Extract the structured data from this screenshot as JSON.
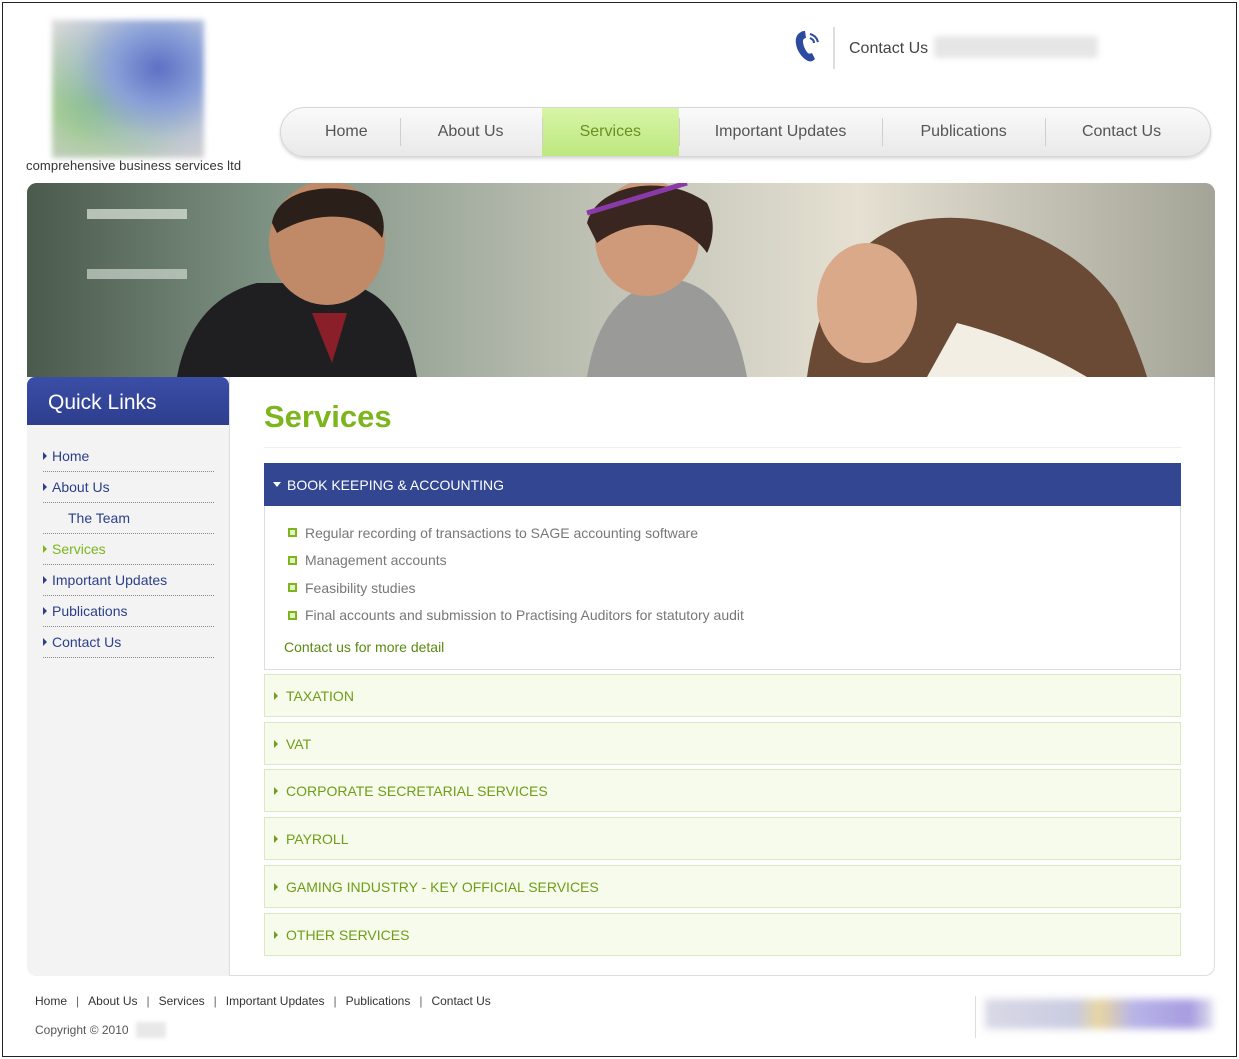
{
  "header": {
    "tagline": "comprehensive business services ltd",
    "contact_label": "Contact Us"
  },
  "nav": {
    "items": [
      {
        "label": "Home",
        "active": false
      },
      {
        "label": "About Us",
        "active": false
      },
      {
        "label": "Services",
        "active": true
      },
      {
        "label": "Important Updates",
        "active": false
      },
      {
        "label": "Publications",
        "active": false
      },
      {
        "label": "Contact Us",
        "active": false
      }
    ]
  },
  "sidebar": {
    "title": "Quick Links",
    "items": [
      {
        "label": "Home"
      },
      {
        "label": "About Us"
      },
      {
        "label": "The Team"
      },
      {
        "label": "Services"
      },
      {
        "label": "Important Updates"
      },
      {
        "label": "Publications"
      },
      {
        "label": "Contact Us"
      }
    ]
  },
  "main": {
    "title": "Services",
    "open_section": {
      "label": "BOOK KEEPING & ACCOUNTING",
      "bullets": [
        "Regular recording of transactions to SAGE accounting software",
        "Management accounts",
        "Feasibility studies",
        "Final accounts and submission to Practising Auditors for statutory audit"
      ],
      "more_link": "Contact us for more detail"
    },
    "sections": [
      "TAXATION",
      "VAT",
      "CORPORATE SECRETARIAL SERVICES",
      "PAYROLL",
      "GAMING INDUSTRY - KEY OFFICIAL SERVICES",
      "OTHER SERVICES"
    ]
  },
  "footer": {
    "links": [
      "Home",
      "About Us",
      "Services",
      "Important Updates",
      "Publications",
      "Contact Us"
    ],
    "copyright": "Copyright © 2010"
  },
  "colors": {
    "brand_blue": "#324692",
    "brand_green": "#7cb51c"
  }
}
